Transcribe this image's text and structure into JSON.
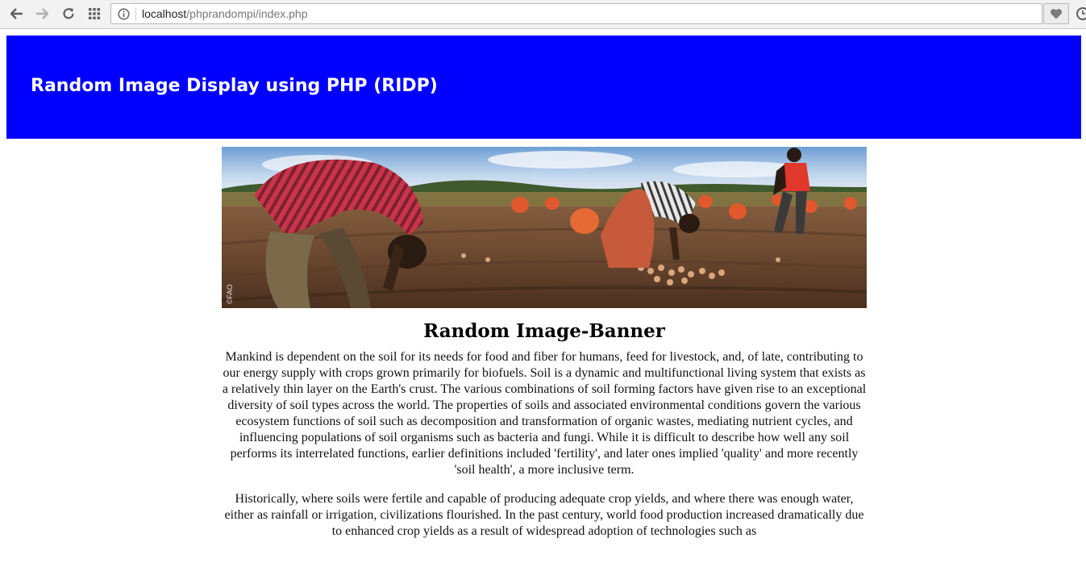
{
  "browser": {
    "url_host": "localhost",
    "url_path": "/phprandompi/index.php",
    "icons": {
      "back": "arrow-left-icon",
      "forward": "arrow-right-icon",
      "reload": "reload-icon",
      "apps": "apps-grid-icon",
      "site_info": "site-info-icon",
      "bookmark": "heart-icon",
      "overflow": "clock-icon"
    }
  },
  "header": {
    "title": "Random Image Display using PHP (RIDP)",
    "background_color": "#0000ff",
    "text_color": "#ffffff"
  },
  "banner": {
    "watermark": "©FAO"
  },
  "article": {
    "heading": "Random Image-Banner",
    "paragraphs": [
      "Mankind is dependent on the soil for its needs for food and fiber for humans, feed for livestock, and, of late, contributing to our energy supply with crops grown primarily for biofuels. Soil is a dynamic and multifunctional living system that exists as a relatively thin layer on the Earth's crust. The various combinations of soil forming factors have given rise to an exceptional diversity of soil types across the world. The properties of soils and associated environmental conditions govern the various ecosystem functions of soil such as decomposition and transformation of organic wastes, mediating nutrient cycles, and influencing populations of soil organisms such as bacteria and fungi. While it is difficult to describe how well any soil performs its interrelated functions, earlier definitions included 'fertility', and later ones implied 'quality' and more recently 'soil health', a more inclusive term.",
      "Historically, where soils were fertile and capable of producing adequate crop yields, and where there was enough water, either as rainfall or irrigation, civilizations flourished. In the past century, world food production increased dramatically due to enhanced crop yields as a result of widespread adoption of technologies such as"
    ]
  }
}
